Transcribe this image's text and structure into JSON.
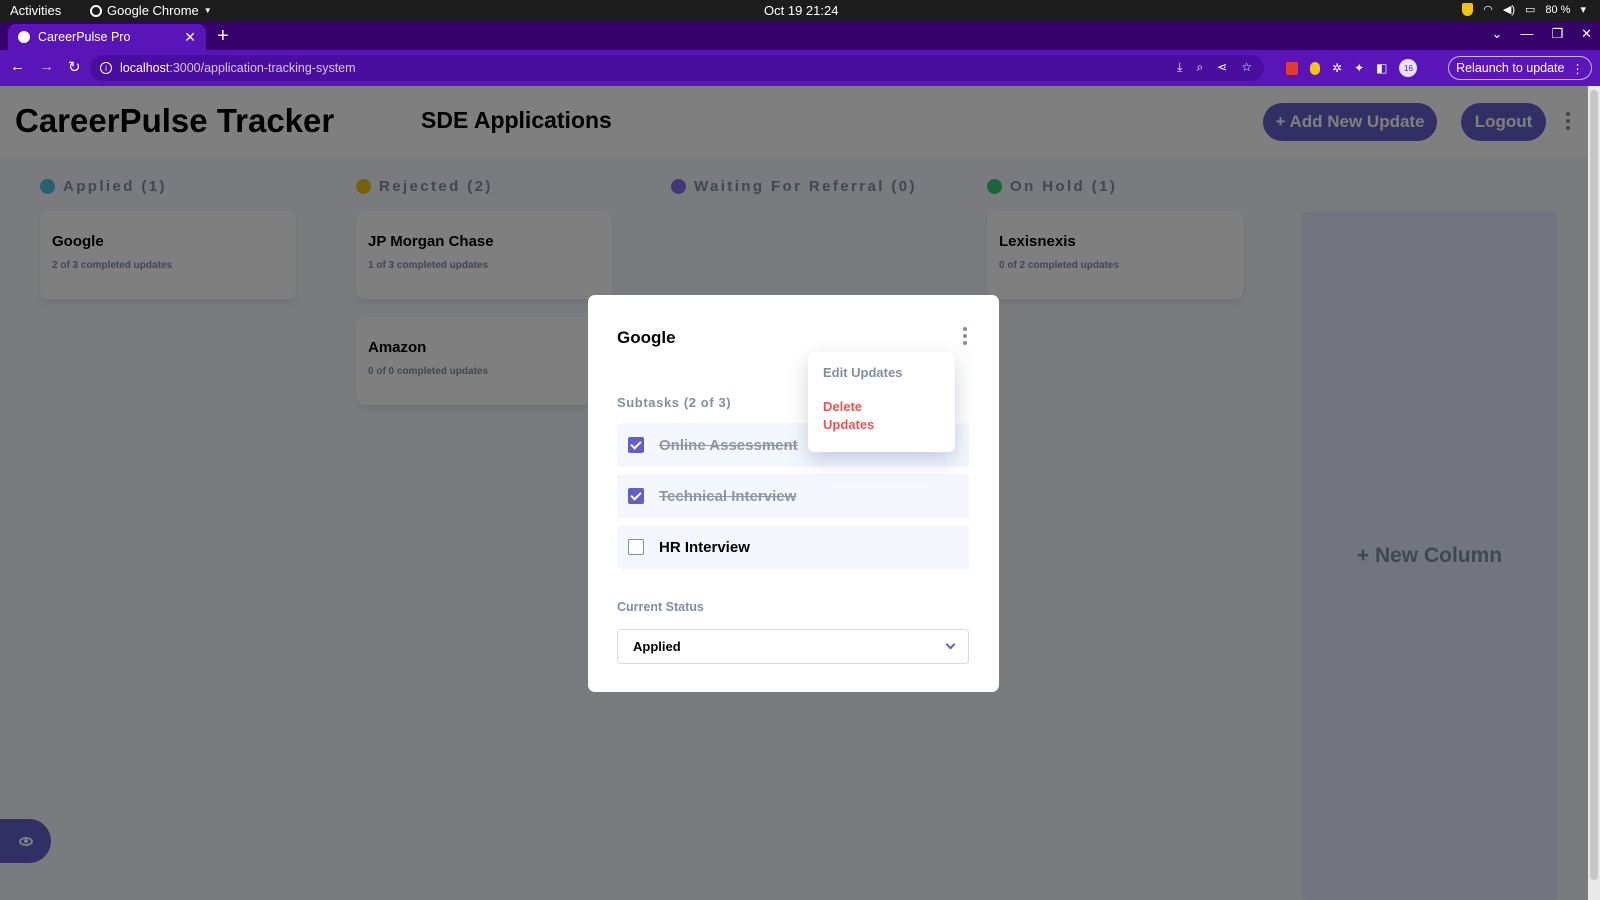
{
  "system": {
    "activities": "Activities",
    "app_menu": "Google Chrome",
    "clock": "Oct 19  21:24",
    "battery": "80 %"
  },
  "browser": {
    "tab_title": "CareerPulse Pro",
    "url_host": "localhost",
    "url_path": ":3000/application-tracking-system",
    "relaunch_label": "Relaunch to update",
    "profile_badge": "16"
  },
  "header": {
    "brand": "CareerPulse Tracker",
    "board_name": "SDE Applications",
    "add_button": "+ Add New Update",
    "logout_button": "Logout"
  },
  "columns": [
    {
      "label": "Applied (1)",
      "color": "#49c4e5",
      "cards": [
        {
          "title": "Google",
          "sub": "2 of 3 completed updates"
        }
      ]
    },
    {
      "label": "Rejected (2)",
      "color": "#f1c40f",
      "cards": [
        {
          "title": "JP Morgan Chase",
          "sub": "1 of 3 completed updates"
        },
        {
          "title": "Amazon",
          "sub": "0 of 0 completed updates"
        }
      ]
    },
    {
      "label": "Waiting For Referral (0)",
      "color": "#8471f2",
      "cards": []
    },
    {
      "label": "On Hold (1)",
      "color": "#2ecc71",
      "cards": [
        {
          "title": "Lexisnexis",
          "sub": "0 of 2 completed updates"
        }
      ]
    }
  ],
  "new_column": "+ New Column",
  "modal": {
    "title": "Google",
    "subtasks_heading": "Subtasks (2 of 3)",
    "subtasks": [
      {
        "label": "Online Assessment",
        "done": true
      },
      {
        "label": "Technical Interview",
        "done": true
      },
      {
        "label": "HR Interview",
        "done": false
      }
    ],
    "status_label": "Current Status",
    "status_value": "Applied",
    "menu": {
      "edit": "Edit Updates",
      "delete": "Delete Updates"
    }
  },
  "colors": {
    "accent": "#635fc7",
    "danger": "#ea5555",
    "muted": "#828fa3",
    "browser": "#5a15b8"
  }
}
